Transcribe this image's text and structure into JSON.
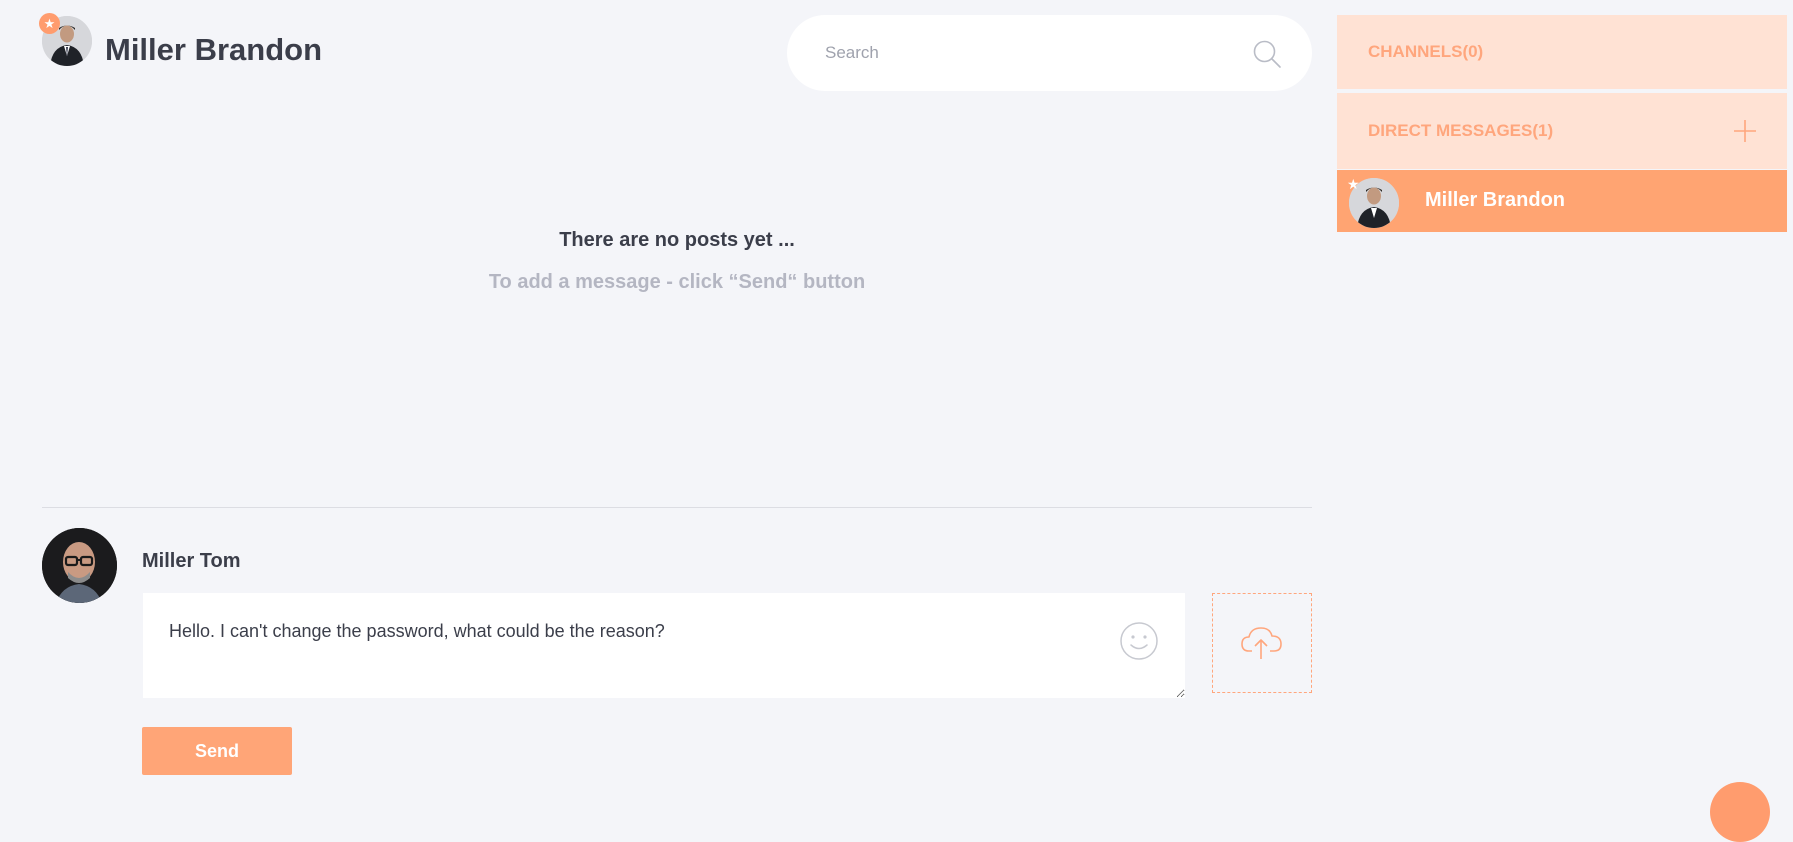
{
  "header": {
    "title": "Miller Brandon",
    "avatar_icon": "user-avatar-icon"
  },
  "search": {
    "placeholder": "Search",
    "value": ""
  },
  "empty_state": {
    "title": "There are no posts yet ...",
    "subtitle": "To add a message - click “Send“ button"
  },
  "composer": {
    "user_name": "Miller Tom",
    "message_value": "Hello. I can't change the password, what could be the reason?",
    "send_label": "Send"
  },
  "sidebar": {
    "channels_label": "CHANNELS(0)",
    "direct_messages_label": "DIRECT MESSAGES(1)",
    "dm_items": [
      {
        "name": "Miller Brandon",
        "favorite": true
      }
    ]
  },
  "colors": {
    "accent": "#ffa472",
    "accent_light": "#ffe2d4",
    "background": "#f4f5f9",
    "text": "#3b3e4a",
    "muted": "#b4b6c2"
  }
}
